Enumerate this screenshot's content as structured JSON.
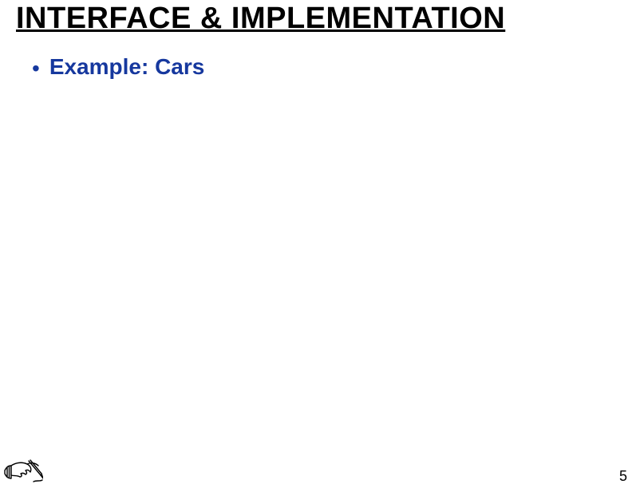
{
  "title": "INTERFACE & IMPLEMENTATION",
  "bullets": [
    {
      "label": "Example: Cars"
    }
  ],
  "page_number": "5",
  "icon": "writing-hand-icon"
}
